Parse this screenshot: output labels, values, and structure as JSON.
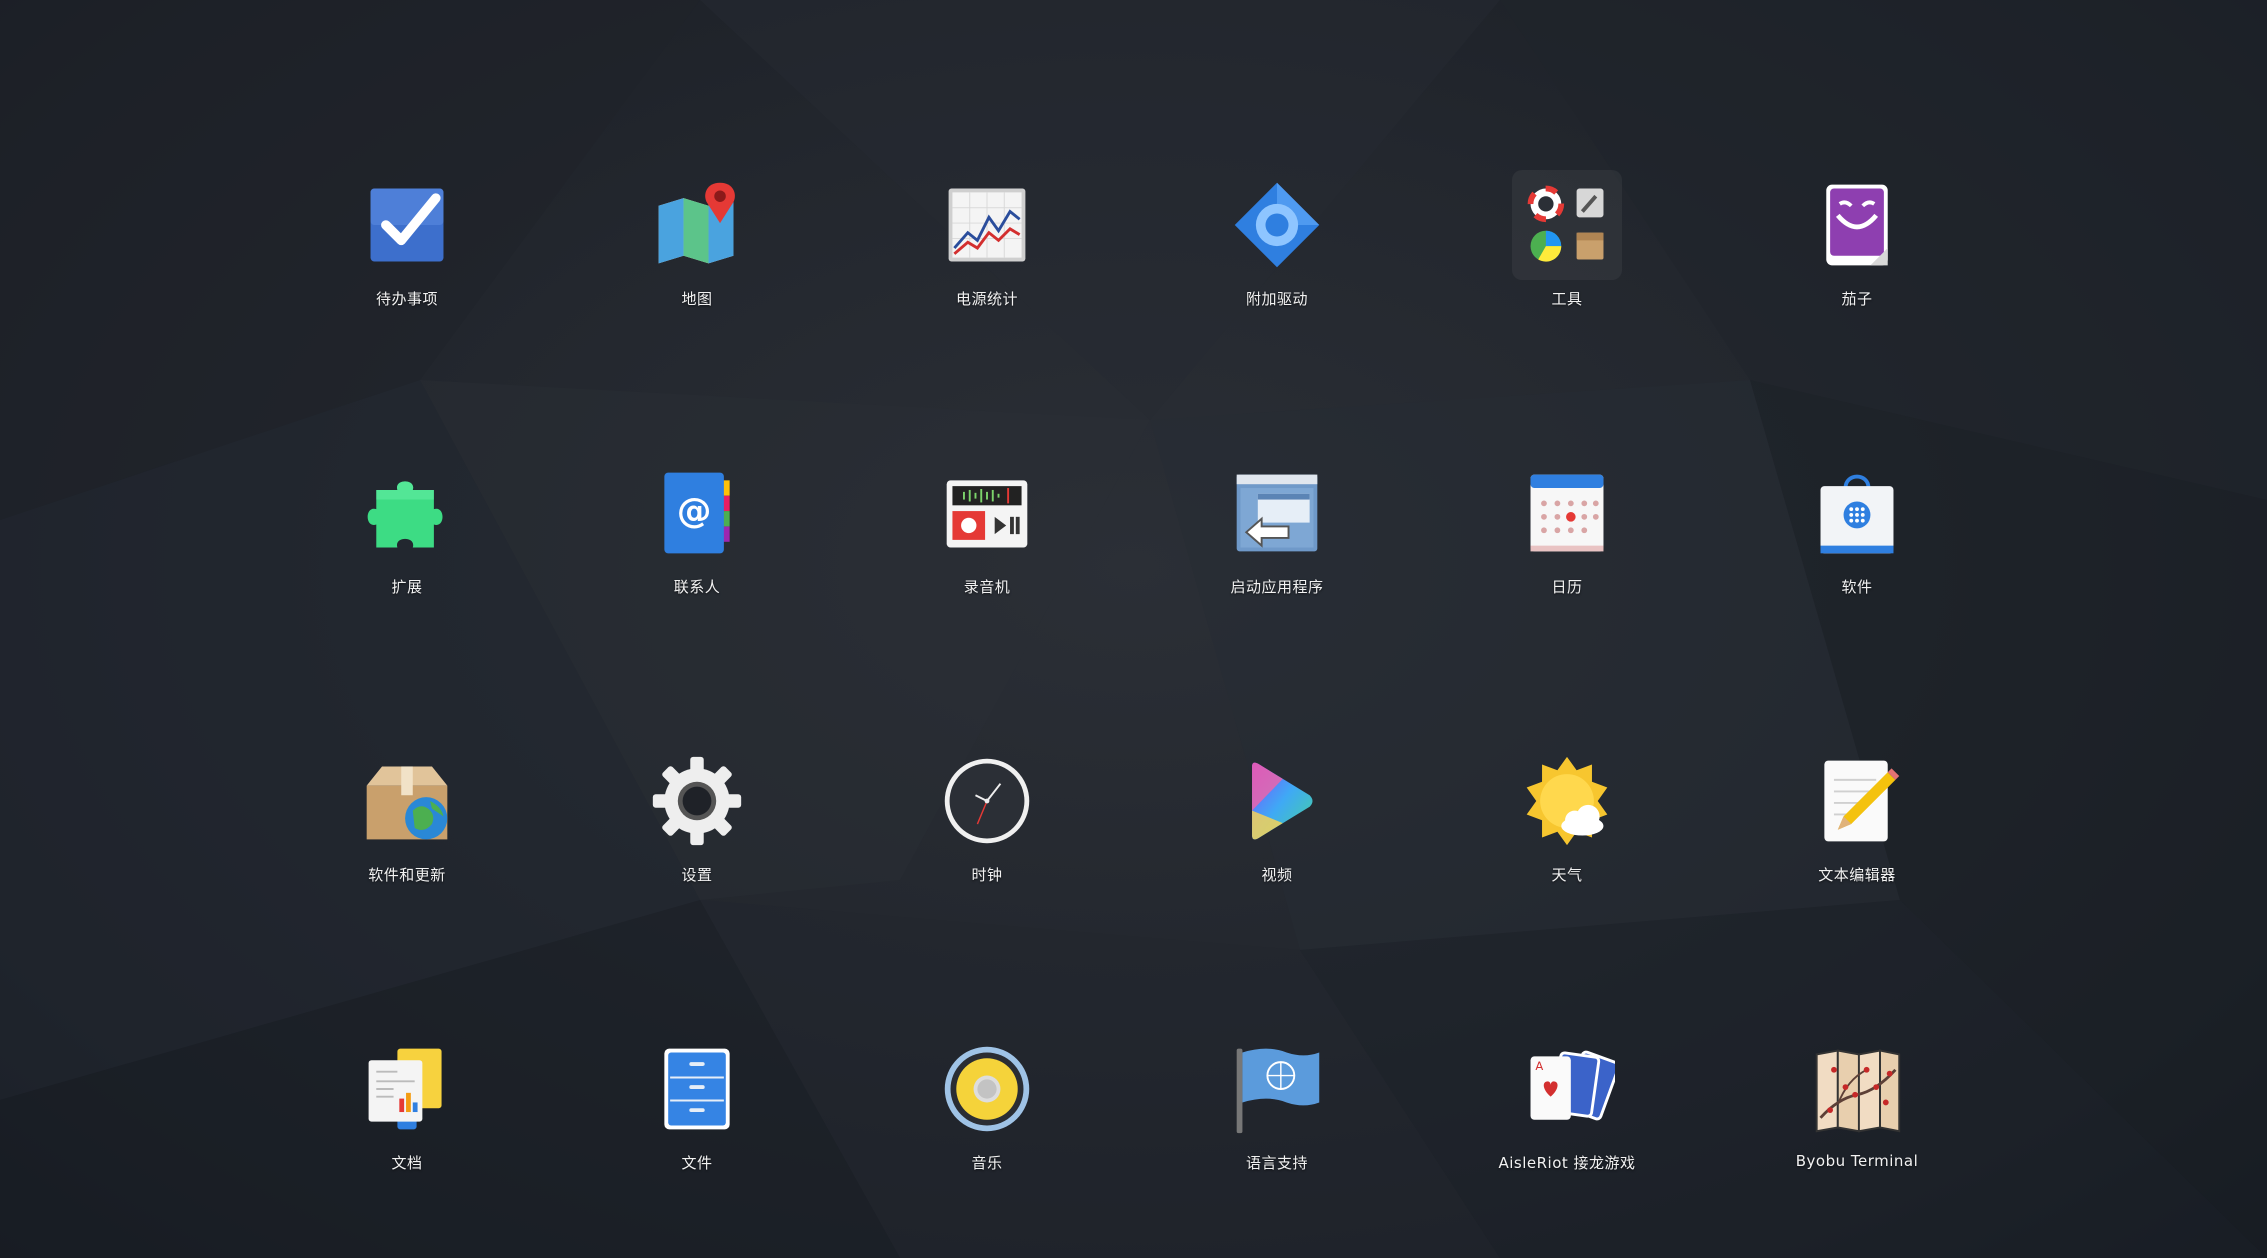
{
  "apps": [
    {
      "label": "待办事项",
      "icon": "checkbox-icon"
    },
    {
      "label": "地图",
      "icon": "map-icon"
    },
    {
      "label": "电源统计",
      "icon": "power-stats-icon"
    },
    {
      "label": "附加驱动",
      "icon": "driver-gear-icon"
    },
    {
      "label": "工具",
      "icon": "tools-folder-icon"
    },
    {
      "label": "茄子",
      "icon": "cheese-icon"
    },
    {
      "label": "扩展",
      "icon": "puzzle-icon"
    },
    {
      "label": "联系人",
      "icon": "contacts-icon"
    },
    {
      "label": "录音机",
      "icon": "sound-recorder-icon"
    },
    {
      "label": "启动应用程序",
      "icon": "startup-apps-icon"
    },
    {
      "label": "日历",
      "icon": "calendar-icon"
    },
    {
      "label": "软件",
      "icon": "software-bag-icon"
    },
    {
      "label": "软件和更新",
      "icon": "software-updates-icon"
    },
    {
      "label": "设置",
      "icon": "settings-gear-icon"
    },
    {
      "label": "时钟",
      "icon": "clock-icon"
    },
    {
      "label": "视频",
      "icon": "video-play-icon"
    },
    {
      "label": "天气",
      "icon": "weather-icon"
    },
    {
      "label": "文本编辑器",
      "icon": "text-editor-icon"
    },
    {
      "label": "文档",
      "icon": "documents-icon"
    },
    {
      "label": "文件",
      "icon": "files-cabinet-icon"
    },
    {
      "label": "音乐",
      "icon": "music-speaker-icon"
    },
    {
      "label": "语言支持",
      "icon": "language-flag-icon"
    },
    {
      "label": "AisleRiot 接龙游戏",
      "icon": "cards-icon"
    },
    {
      "label": "Byobu Terminal",
      "icon": "byobu-screen-icon"
    }
  ]
}
